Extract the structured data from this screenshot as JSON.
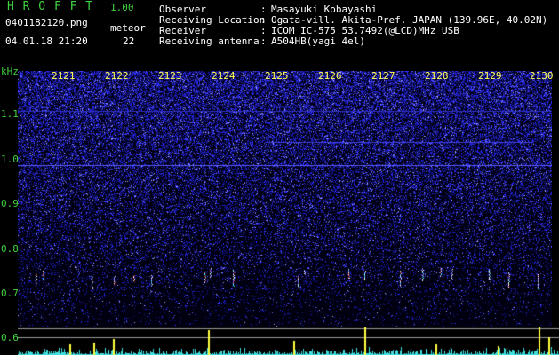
{
  "header": {
    "app_title": "H R O F F T",
    "app_version": "1.00",
    "filename": "0401182120.png",
    "datetime": "04.01.18 21:20",
    "meteor_label": "meteor",
    "meteor_count": "22"
  },
  "station_info": [
    {
      "label": "Observer",
      "value": "Masayuki Kobayashi"
    },
    {
      "label": "Receiving Location",
      "value": "Ogata-vill. Akita-Pref. JAPAN (139.96E, 40.02N)"
    },
    {
      "label": "Receiver",
      "value": "ICOM IC-575 53.7492(@LCD)MHz USB"
    },
    {
      "label": "Receiving antenna",
      "value": "A504HB(yagi 4el)"
    }
  ],
  "axis": {
    "unit_label": "kHz",
    "minute_labels": [
      "2121",
      "2122",
      "2123",
      "2124",
      "2125",
      "2126",
      "2127",
      "2128",
      "2129",
      "2130"
    ],
    "freq_labels": [
      "1.1",
      "1.0",
      "0.9",
      "0.8",
      "0.7",
      "0.6"
    ]
  },
  "colors": {
    "label_green": "#3fd23f",
    "label_white": "#ffffff",
    "minute_yellow": "#ffff55",
    "noise_blue": "#2a2aff",
    "carrier": "#5a5aff",
    "level_cyan": "#40e0e0",
    "level_peak_yellow": "#ffff40",
    "threshold_line": "#9a9a9a"
  },
  "icons": {
    "spectrogram": "waterfall-spectrogram",
    "level_graph": "signal-level-graph"
  }
}
